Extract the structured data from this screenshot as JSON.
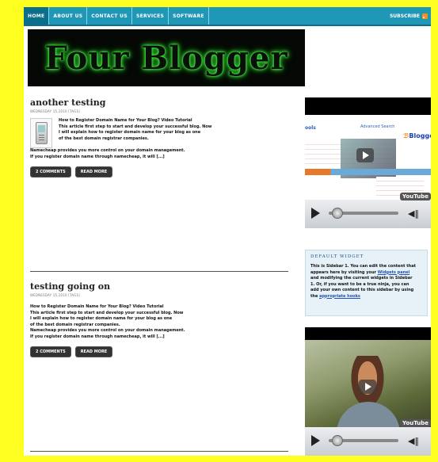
{
  "nav": {
    "items": [
      "HOME",
      "ABOUT US",
      "CONTACT US",
      "SERVICES",
      "SOFTWARE"
    ],
    "subscribe_label": "SUBSCRIBE"
  },
  "header": {
    "logo_text": "Four Blogger"
  },
  "posts": [
    {
      "title": "another testing",
      "meta": "WEDNESDAY 15,2010 [TAGS]",
      "excerpt_lines": [
        "How to Register Domain Name for Your Blog? Video Tutorial",
        "This article first step to start and develop your successful blog. Now",
        "I will explain how to register domain name for your blog as one",
        "of the best domain registrar companies."
      ],
      "excerpt_full_lines": [
        "Namecheap provides you more control on your domain management.",
        "If you register domain name through namecheap, it will [...]"
      ],
      "comments_label": "2 COMMENTS",
      "readmore_label": "READ MORE"
    },
    {
      "title": "testing going on",
      "meta": "WEDNESDAY 15,2010 [TAGS]",
      "excerpt_lines": [
        "How to Register Domain Name for Your Blog? Video Tutorial",
        "This article first step to start and develop your successful blog. Now",
        "I will explain how to register domain name for your blog as one",
        "of the best domain registrar companies.",
        "Namecheap provides you more control on your domain management.",
        "If you register domain name through namecheap, it will [...]"
      ],
      "comments_label": "2 COMMENTS",
      "readmore_label": "READ MORE"
    }
  ],
  "sidebar": {
    "video1": {
      "link_text": "ools",
      "advanced_search": "Advanced Search",
      "blogger_text": "Blogger",
      "youtube_label": "YouTube"
    },
    "widget": {
      "title": "DEFAULT WIDGET",
      "text_lines": [
        "This is Sidebar 1. You can edit the content that",
        "appears here by visiting your",
        "and modifying the current widgets in Sidebar",
        "1. Or, if you want to be a true ninja, you can",
        "add your own content to this sidebar by using",
        "the"
      ],
      "link1": "Widgets panel",
      "link2": "appropriate hooks"
    },
    "video2": {
      "youtube_label": "YouTube"
    }
  },
  "colors": {
    "frame": "#ffff22",
    "nav_bg": "#1f97b7",
    "logo_glow": "#3fe03f"
  }
}
